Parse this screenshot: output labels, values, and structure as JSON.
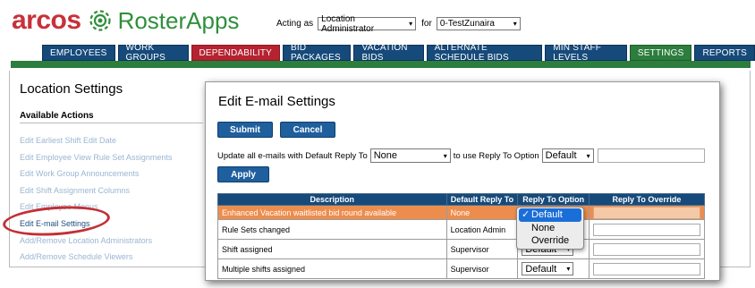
{
  "app": {
    "brand": "arcos",
    "product": "RosterApps",
    "acting_as_label": "Acting as",
    "role_value": "Location Administrator",
    "for_label": "for",
    "location_value": "0-TestZunaira",
    "colors": {
      "nav": "#164a7a",
      "dependability": "#b52331",
      "settings": "#2c7d3e",
      "highlight_row": "#ec8d4e"
    }
  },
  "tabs": [
    "EMPLOYEES",
    "WORK GROUPS",
    "DEPENDABILITY",
    "BID PACKAGES",
    "VACATION BIDS",
    "ALTERNATE SCHEDULE BIDS",
    "MIN STAFF LEVELS",
    "SETTINGS",
    "REPORTS"
  ],
  "left": {
    "title": "Location Settings",
    "available_actions": "Available Actions",
    "actions": [
      "Edit Earliest Shift Edit Date",
      "Edit Employee View Rule Set Assignments",
      "Edit Work Group Announcements",
      "Edit Shift Assignment Columns",
      "Edit Employee Menus",
      "Edit E-mail Settings",
      "Add/Remove Location Administrators",
      "Add/Remove Schedule Viewers"
    ]
  },
  "modal": {
    "title": "Edit E-mail Settings",
    "submit": "Submit",
    "cancel": "Cancel",
    "update_prefix": "Update all e-mails with Default Reply To",
    "default_reply_value": "None",
    "update_middle": "to use Reply To Option",
    "reply_option_value": "Default",
    "apply": "Apply",
    "columns": [
      "Description",
      "Default Reply To",
      "Reply To Option",
      "Reply To Override"
    ],
    "rows": [
      {
        "description": "Enhanced Vacation waitlisted bid round available",
        "default_reply_to": "None",
        "option": "Default"
      },
      {
        "description": "Rule Sets changed",
        "default_reply_to": "Location Admin",
        "option": "Default"
      },
      {
        "description": "Shift assigned",
        "default_reply_to": "Supervisor",
        "option": "Default"
      },
      {
        "description": "Multiple shifts assigned",
        "default_reply_to": "Supervisor",
        "option": "Default"
      }
    ],
    "dropdown_options": [
      "Default",
      "None",
      "Override"
    ]
  }
}
